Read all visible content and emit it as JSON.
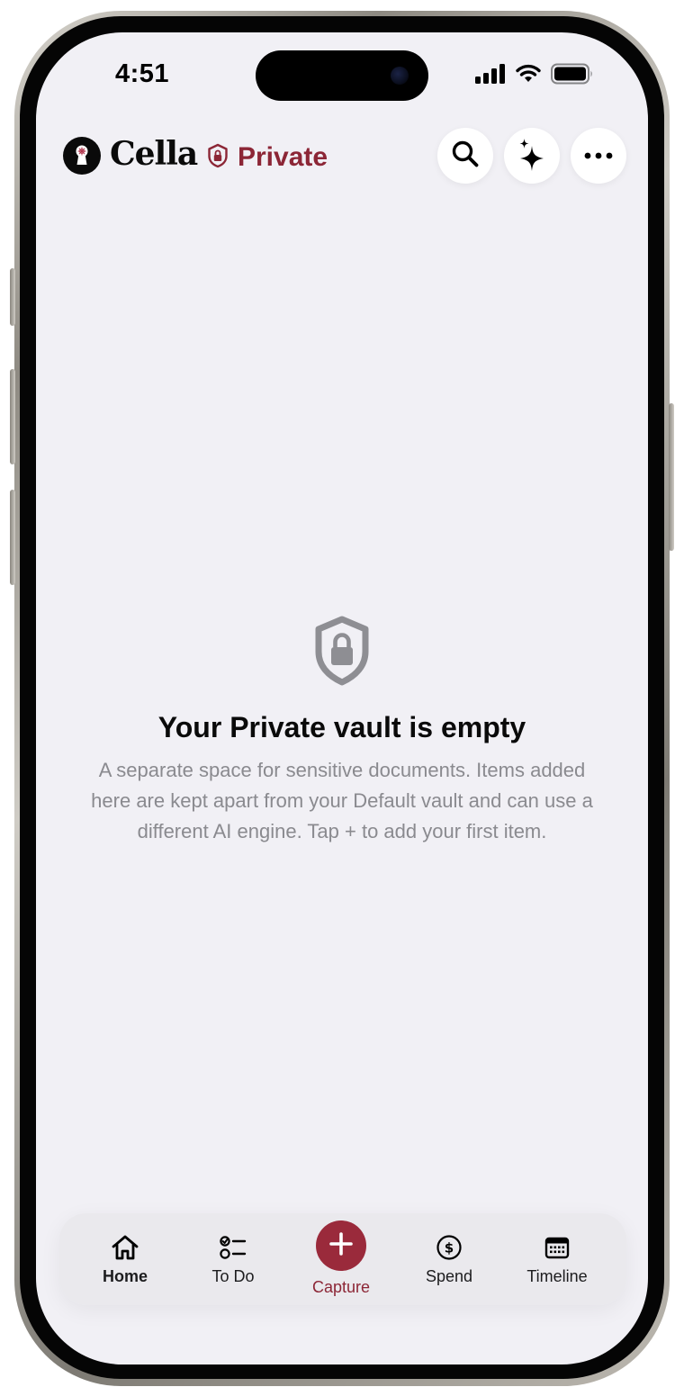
{
  "status_bar": {
    "time": "4:51",
    "signal_icon": "cellular-signal-icon",
    "wifi_icon": "wifi-icon",
    "battery_icon": "battery-icon"
  },
  "header": {
    "app_name": "Cella",
    "logo_icon": "keyhole-logo-icon",
    "vault_icon": "shield-lock-icon",
    "vault_name": "Private",
    "actions": [
      {
        "name": "search",
        "icon": "search-icon"
      },
      {
        "name": "ai-assistant",
        "icon": "sparkle-icon"
      },
      {
        "name": "more",
        "icon": "ellipsis-icon"
      }
    ]
  },
  "empty_state": {
    "icon": "shield-lock-icon",
    "title": "Your Private vault is empty",
    "description": "A separate space for sensitive documents. Items added here are kept apart from your Default vault and can use a different AI engine. Tap + to add your first item."
  },
  "tab_bar": {
    "tabs": [
      {
        "label": "Home",
        "icon": "home-icon",
        "active": true
      },
      {
        "label": "To Do",
        "icon": "checklist-icon",
        "active": false
      },
      {
        "label": "Capture",
        "icon": "plus-icon",
        "active": false
      },
      {
        "label": "Spend",
        "icon": "dollar-circle-icon",
        "active": false
      },
      {
        "label": "Timeline",
        "icon": "calendar-icon",
        "active": false
      }
    ]
  },
  "colors": {
    "accent": "#8c2636",
    "capture_button": "#9a2a3b",
    "screen_background": "#f1f0f5",
    "secondary_text": "#8a8a8f",
    "empty_icon": "#8e8e93"
  }
}
